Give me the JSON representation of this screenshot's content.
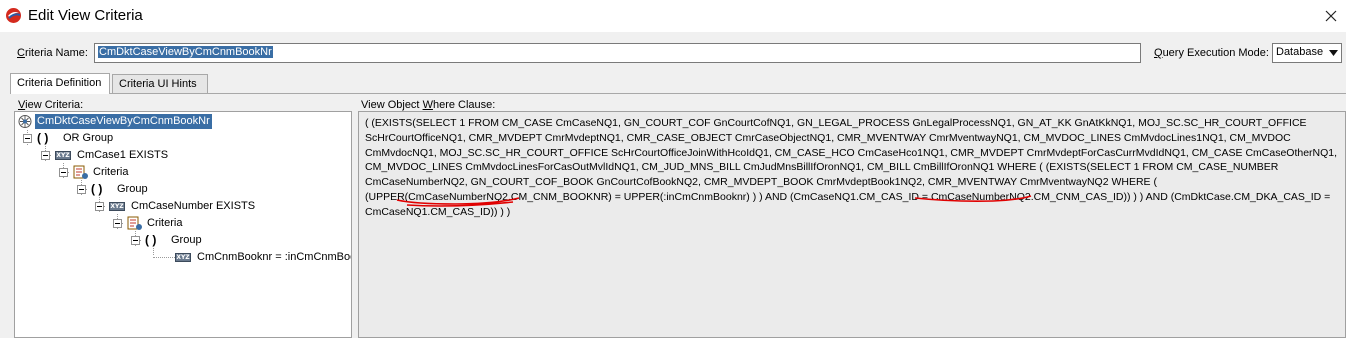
{
  "window": {
    "title": "Edit View Criteria",
    "icon": "oracle-jdeveloper-icon",
    "close_icon": "close-icon"
  },
  "criteria_name": {
    "label": "Criteria Name:",
    "value": "CmDktCaseViewByCmCnmBookNr"
  },
  "query_execution_mode": {
    "label": "Query Execution Mode:",
    "value": "Database"
  },
  "tabs": [
    {
      "label": "Criteria Definition",
      "active": true
    },
    {
      "label": "Criteria UI Hints",
      "active": false
    }
  ],
  "view_criteria": {
    "label": "View Criteria:",
    "tree": [
      {
        "label": "CmDktCaseViewByCmCnmBookNr",
        "icon": "view-criteria-icon",
        "selected": true
      },
      {
        "label": "OR Group",
        "icon": "group-parens-icon"
      },
      {
        "label": "CmCase1 EXISTS",
        "icon": "xyz-attribute-icon"
      },
      {
        "label": "Criteria",
        "icon": "criteria-icon"
      },
      {
        "label": "Group",
        "icon": "group-parens-icon"
      },
      {
        "label": "CmCaseNumber EXISTS",
        "icon": "xyz-attribute-icon"
      },
      {
        "label": "Criteria",
        "icon": "criteria-icon"
      },
      {
        "label": "Group",
        "icon": "group-parens-icon"
      },
      {
        "label": "CmCnmBooknr = :inCmCnmBook",
        "icon": "xyz-attribute-icon"
      }
    ],
    "xyz_glyph": "XYZ"
  },
  "where_clause": {
    "label": "View Object Where Clause:",
    "lines": [
      "( (EXISTS(SELECT 1 FROM CM_CASE CmCaseNQ1, GN_COURT_COF GnCourtCofNQ1, GN_LEGAL_PROCESS GnLegalProcessNQ1, GN_AT_KK GnAtKkNQ1, MOJ_SC.SC_HR_COURT_OFFICE",
      "ScHrCourtOfficeNQ1, CMR_MVDEPT CmrMvdeptNQ1, CMR_CASE_OBJECT CmrCaseObjectNQ1, CMR_MVENTWAY CmrMventwayNQ1, CM_MVDOC_LINES CmMvdocLines1NQ1, CM_MVDOC",
      "CmMvdocNQ1, MOJ_SC.SC_HR_COURT_OFFICE ScHrCourtOfficeJoinWithHcoIdQ1, CM_CASE_HCO CmCaseHco1NQ1, CMR_MVDEPT CmrMvdeptForCasCurrMvdIdNQ1, CM_CASE CmCaseOtherNQ1,",
      "CM_MVDOC_LINES CmMvdocLinesForCasOutMvlIdNQ1, CM_JUD_MNS_BILL CmJudMnsBillIfOronNQ1, CM_BILL CmBillIfOronNQ1 WHERE  ( (EXISTS(SELECT 1 FROM CM_CASE_NUMBER",
      "CmCaseNumberNQ2, GN_COURT_COF_BOOK GnCourtCofBookNQ2, CMR_MVDEPT_BOOK CmrMvdeptBook1NQ2, CMR_MVENTWAY CmrMventwayNQ2 WHERE  (",
      "(UPPER(CmCaseNumberNQ2.CM_CNM_BOOKNR) = UPPER(:inCmCnmBooknr) ) )  AND (CmCaseNQ1.CM_CAS_ID = CmCaseNumberNQ2.CM_CNM_CAS_ID)) ) )  AND (CmDktCase.CM_DKA_CAS_ID =",
      "CmCaseNQ1.CM_CAS_ID)) ) )"
    ],
    "annotation_color": "#e00000"
  }
}
